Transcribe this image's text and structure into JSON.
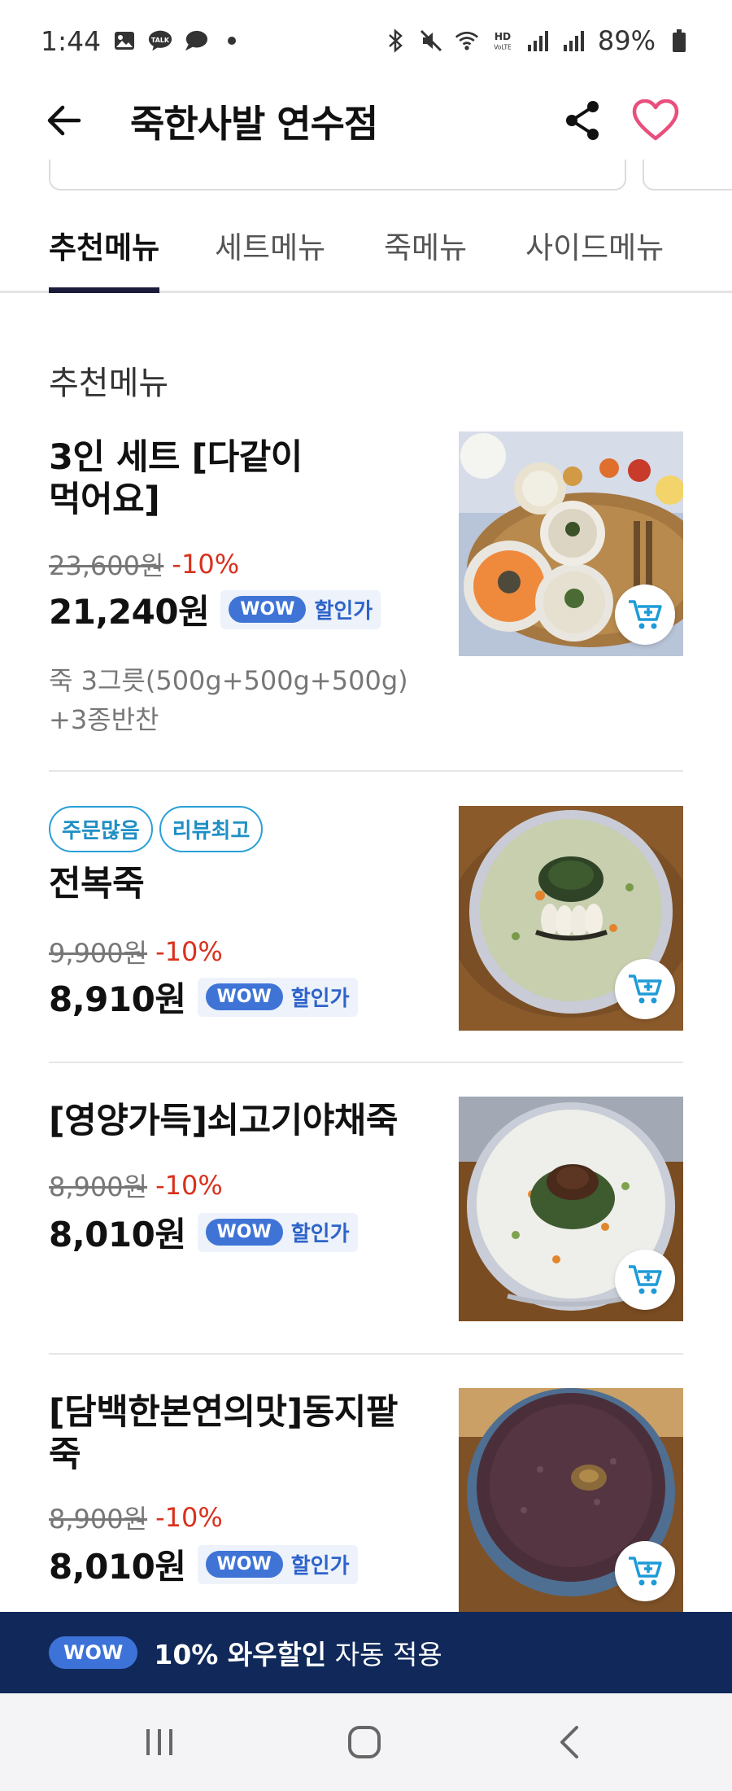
{
  "status_bar": {
    "time": "1:44",
    "battery": "89%",
    "left_icons": [
      "image-icon",
      "talk-icon",
      "chat-bubble-icon",
      "dot-icon"
    ],
    "right_icons": [
      "bluetooth-icon",
      "mute-icon",
      "wifi-icon",
      "hd-voice-icon",
      "signal-icon",
      "signal-icon",
      "battery-icon"
    ]
  },
  "header": {
    "title": "죽한사발 연수점",
    "back_icon": "arrow-left-icon",
    "share_icon": "share-icon",
    "favorite_icon": "heart-icon",
    "favorite_color": "#e94f7c"
  },
  "tabs": [
    {
      "label": "추천메뉴",
      "active": true
    },
    {
      "label": "세트메뉴",
      "active": false
    },
    {
      "label": "죽메뉴",
      "active": false
    },
    {
      "label": "사이드메뉴",
      "active": false
    }
  ],
  "section_title": "추천메뉴",
  "menu_items": [
    {
      "name": "3인 세트 [다같이 먹어요]",
      "original_price": "23,600원",
      "discount": "-10%",
      "final_price": "21,240원",
      "wow_label": "WOW",
      "wow_text": "할인가",
      "description": "죽 3그릇(500g+500g+500g) +3종반찬",
      "badges": []
    },
    {
      "name": "전복죽",
      "original_price": "9,900원",
      "discount": "-10%",
      "final_price": "8,910원",
      "wow_label": "WOW",
      "wow_text": "할인가",
      "description": "",
      "badges": [
        "주문많음",
        "리뷰최고"
      ]
    },
    {
      "name": "[영양가득]쇠고기야채죽",
      "original_price": "8,900원",
      "discount": "-10%",
      "final_price": "8,010원",
      "wow_label": "WOW",
      "wow_text": "할인가",
      "description": "",
      "badges": []
    },
    {
      "name": "[담백한본연의맛]동지팥죽",
      "original_price": "8,900원",
      "discount": "-10%",
      "final_price": "8,010원",
      "wow_label": "WOW",
      "wow_text": "할인가",
      "description": "",
      "badges": []
    }
  ],
  "banner": {
    "wow_label": "WOW",
    "bold_text": "10% 와우할인",
    "text": " 자동 적용",
    "background": "#10295a"
  },
  "colors": {
    "discount": "#d9311d",
    "wow_blue": "#3f74d6",
    "badge_blue": "#1f8fc4",
    "tab_indicator": "#1b1b3a"
  },
  "nav_icons": [
    "recent-apps-icon",
    "home-icon",
    "back-icon"
  ]
}
